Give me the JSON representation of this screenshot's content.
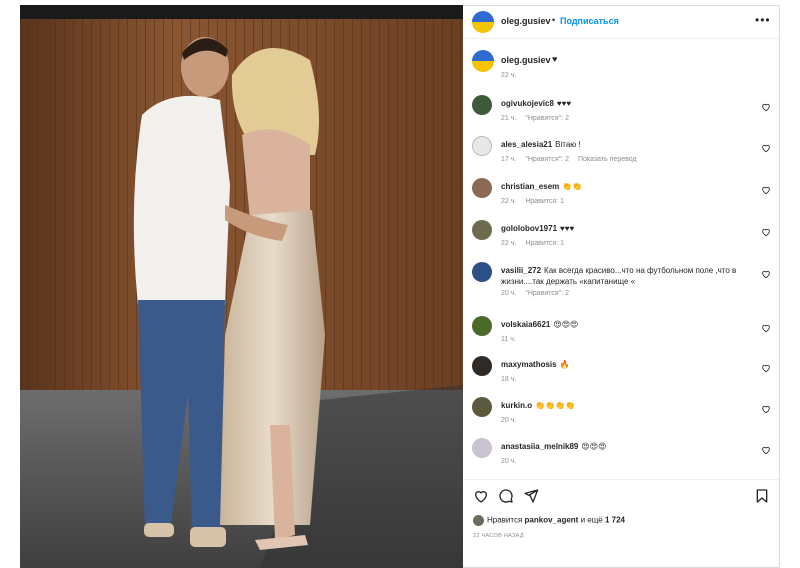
{
  "colors": {
    "accent": "#0095f6",
    "muted": "#8e8e8e",
    "text": "#262626"
  },
  "post": {
    "username": "oleg.gusiev",
    "separator": "•",
    "follow_label": "Подписаться",
    "more_icon": "ellipsis-icon",
    "caption_text": "♥",
    "caption_time": "22 ч."
  },
  "comments": [
    {
      "user": "ogivukojevic8",
      "text": "♥♥♥",
      "time": "21 ч.",
      "likes": "\"Нравится\": 2",
      "extra": ""
    },
    {
      "user": "ales_alesia21",
      "text": "Вітаю !",
      "time": "17 ч.",
      "likes": "\"Нравится\": 2",
      "extra": "Показать перевод"
    },
    {
      "user": "christian_esem",
      "text": "👏👏",
      "time": "22 ч.",
      "likes": "Нравится: 1",
      "extra": ""
    },
    {
      "user": "gololobov1971",
      "text": "♥♥♥",
      "time": "22 ч.",
      "likes": "Нравится: 1",
      "extra": ""
    },
    {
      "user": "vasilii_272",
      "text": "Как всегда красиво...что на футбольном поле ,что в жизни....так держать «капитанище «",
      "time": "20 ч.",
      "likes": "\"Нравится\": 2",
      "extra": ""
    },
    {
      "user": "volskaia6621",
      "text": "😍😍😍",
      "time": "11 ч.",
      "likes": "",
      "extra": ""
    },
    {
      "user": "maxymathosis",
      "text": "🔥",
      "time": "18 ч.",
      "likes": "",
      "extra": ""
    },
    {
      "user": "kurkin.o",
      "text": "👏👏👏👏",
      "time": "20 ч.",
      "likes": "",
      "extra": ""
    },
    {
      "user": "anastasiia_melnik89",
      "text": "😍😍😍",
      "time": "20 ч.",
      "likes": "",
      "extra": ""
    }
  ],
  "actions": {
    "like_icon": "heart-icon",
    "comment_icon": "comment-icon",
    "share_icon": "share-icon",
    "save_icon": "bookmark-icon"
  },
  "likes": {
    "prefix": "Нравится",
    "user": "pankov_agent",
    "middle": "и ещё",
    "count": "1 724"
  },
  "posted_ago": "22 ЧАСОВ НАЗАД"
}
